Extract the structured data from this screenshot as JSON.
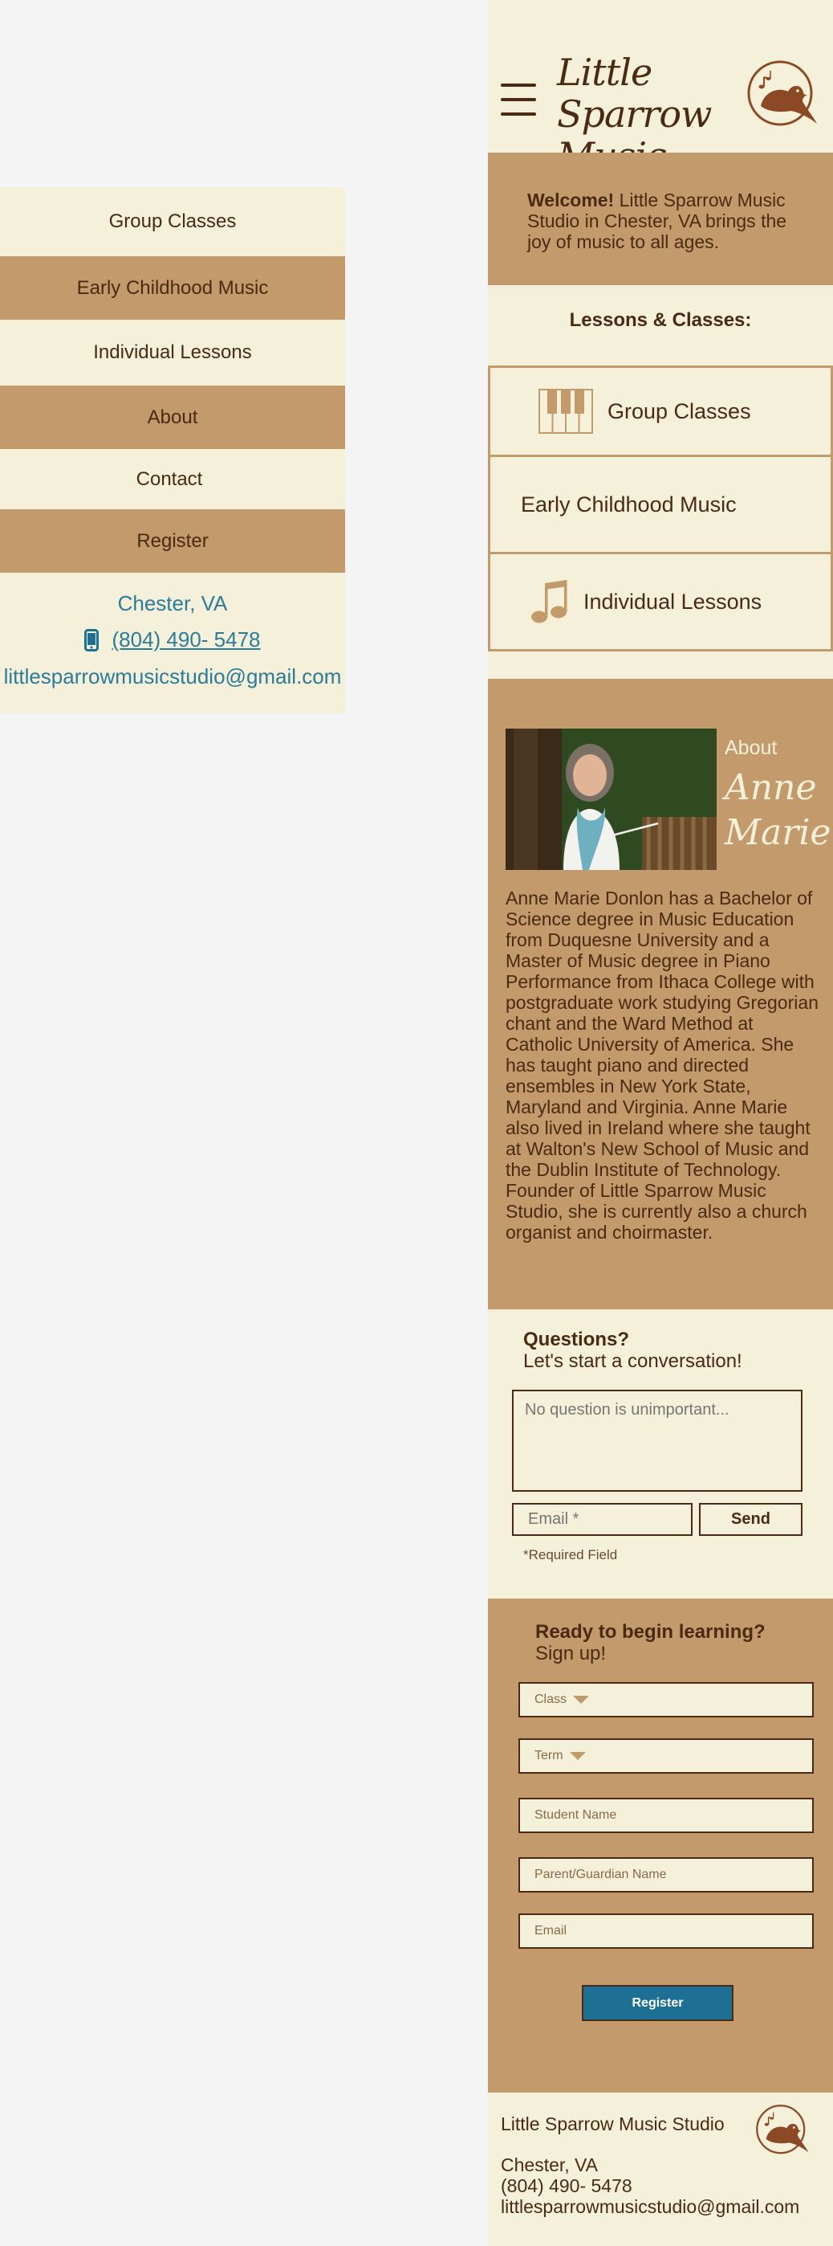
{
  "side_menu": {
    "items": [
      {
        "label": "Group Classes"
      },
      {
        "label": "Early Childhood Music"
      },
      {
        "label": "Individual Lessons"
      },
      {
        "label": "About"
      },
      {
        "label": "Contact"
      },
      {
        "label": "Register"
      }
    ],
    "location": "Chester, VA",
    "phone": "(804) 490- 5478",
    "email": "littlesparrowmusicstudio@gmail.com"
  },
  "header": {
    "logo_line1": "Little Sparrow",
    "logo_line2": "Music Studio"
  },
  "welcome": {
    "bold": "Welcome!",
    "text": " Little Sparrow Music Studio in Chester, VA brings the joy of music to all ages."
  },
  "lessons": {
    "heading": "Lessons & Classes:",
    "items": [
      {
        "label": "Group Classes",
        "icon": "piano-keys-icon"
      },
      {
        "label": "Early Childhood Music",
        "icon": ""
      },
      {
        "label": "Individual Lessons",
        "icon": "music-note-icon"
      }
    ]
  },
  "about": {
    "label": "About",
    "name_line1": "Anne",
    "name_line2": "Marie",
    "bio_name": "Anne Marie Donlon",
    "bio": " has a Bachelor of Science degree in Music Education from Duquesne University and a Master of Music degree in Piano Performance from Ithaca College with postgraduate work studying Gregorian chant and the Ward Method at Catholic University of America. She has taught piano and directed ensembles in New York State, Maryland and Virginia. Anne Marie also lived in Ireland where she taught at Walton's New School of Music and the Dublin Institute of Technology. Founder of Little Sparrow Music Studio, she is currently also a church organist and choirmaster."
  },
  "questions": {
    "title": "Questions?",
    "subtitle": "Let's start a conversation!",
    "message_placeholder": "No question is unimportant...",
    "email_placeholder": "Email *",
    "send_label": "Send",
    "required_note": "*Required Field"
  },
  "signup": {
    "title": "Ready to begin learning?",
    "subtitle": "Sign up!",
    "class_label": "Class",
    "term_label": "Term",
    "student_placeholder": "Student Name",
    "parent_placeholder": "Parent/Guardian Name",
    "email_placeholder": "Email",
    "register_label": "Register"
  },
  "footer": {
    "name": "Little Sparrow Music Studio",
    "location": "Chester, VA",
    "phone": "(804) 490- 5478",
    "email": "littlesparrowmusicstudio@gmail.com"
  },
  "colors": {
    "cream": "#f4f0d9",
    "tan": "#c39a6b",
    "brown": "#4a2a12",
    "link_blue": "#2b7b99",
    "button_blue": "#1e6f94"
  }
}
